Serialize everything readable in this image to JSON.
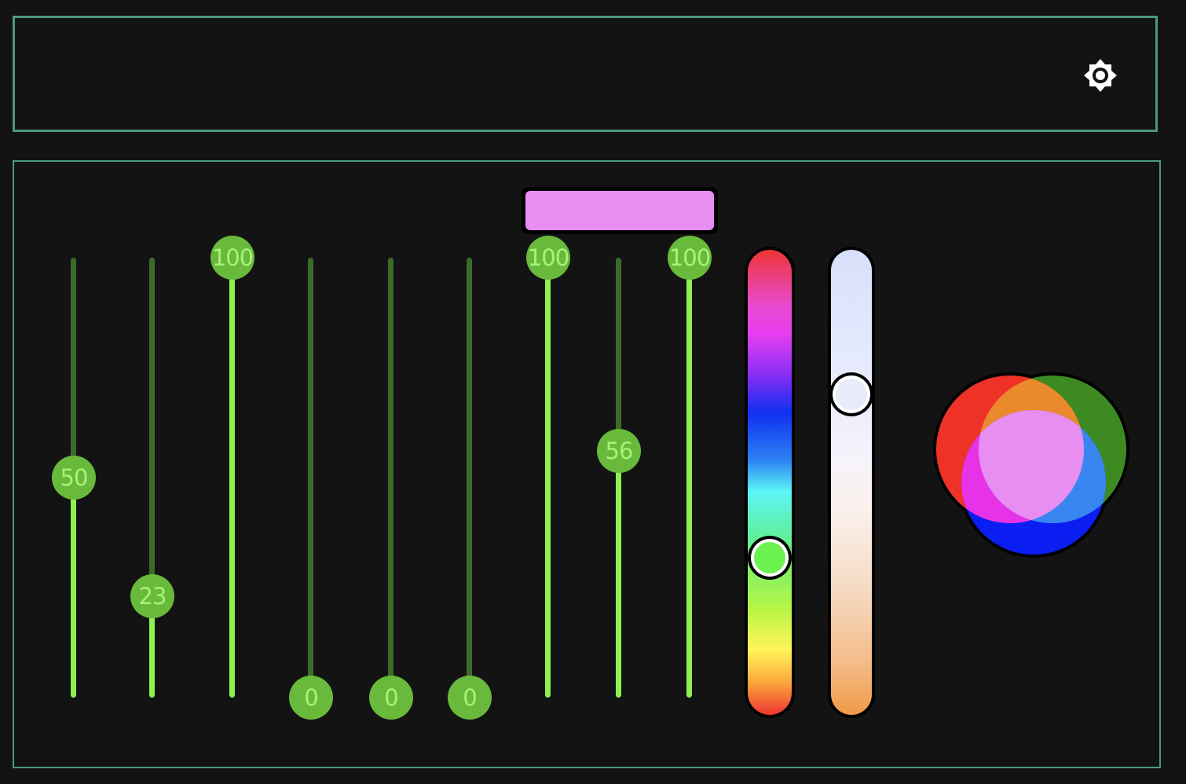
{
  "header": {
    "settings_icon": "brightness-gear-icon"
  },
  "preview": {
    "color": "#e88ef2"
  },
  "sliders": [
    {
      "id": "1",
      "value": "50",
      "level": 50
    },
    {
      "id": "2",
      "value": "23",
      "level": 23
    },
    {
      "id": "3",
      "value": "100",
      "level": 100
    },
    {
      "id": "4",
      "value": "0",
      "level": 0
    },
    {
      "id": "5",
      "value": "0",
      "level": 0
    },
    {
      "id": "6",
      "value": "0",
      "level": 0
    },
    {
      "id": "7",
      "value": "100",
      "level": 100
    },
    {
      "id": "8",
      "value": "56",
      "level": 56
    },
    {
      "id": "9",
      "value": "100",
      "level": 100
    }
  ],
  "hue_slider": {
    "selected_color": "#6cf24f",
    "level": 0.68
  },
  "temperature_slider": {
    "selected_color": "#e8ebfa",
    "level": 0.31
  },
  "rgb_mixer": {
    "red": "#ee3228",
    "green": "#3e8a22",
    "blue": "#0a1ef2"
  },
  "colors": {
    "panel_border": "#4a9a7e",
    "background": "#131313",
    "slider_active": "#8ff04f",
    "slider_inactive": "#3c6b28",
    "knob": "#69ba3c",
    "knob_text": "#a6f37a"
  }
}
